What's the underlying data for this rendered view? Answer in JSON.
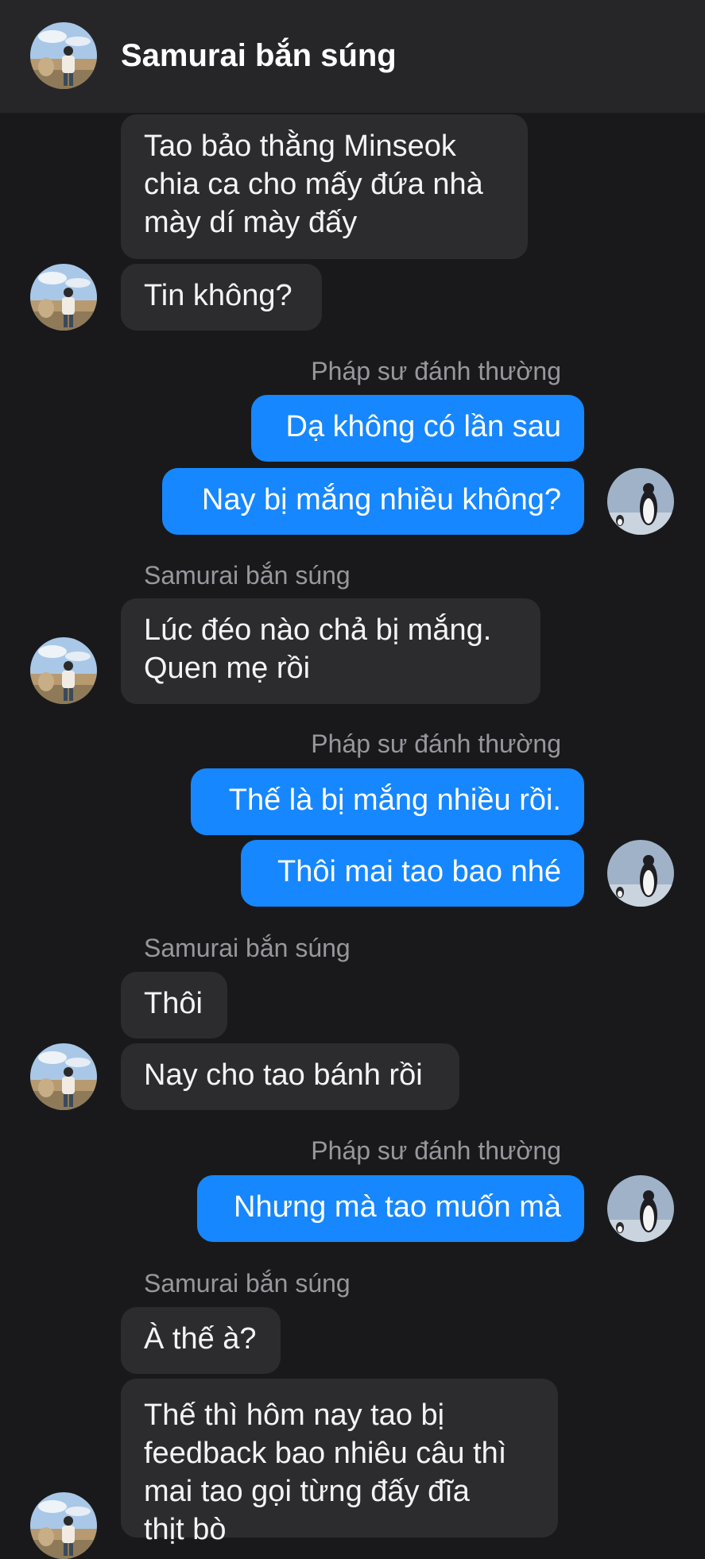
{
  "header": {
    "title": "Samurai bắn súng",
    "avatar_icon": "contact-avatar-photo-icon"
  },
  "colors": {
    "background": "#19191b",
    "header": "#262628",
    "incoming_bubble": "#2c2c2f",
    "outgoing_bubble": "#1687ff",
    "sender_label": "#97979d"
  },
  "messages": {
    "m1": {
      "direction": "incoming",
      "text": "Tao bảo thằng Minseok\nchia ca cho mấy đứa nhà\nmày dí mày đấy"
    },
    "m2": {
      "direction": "incoming",
      "text": "Tin không?"
    },
    "s1": {
      "sender": "Pháp sư đánh thường"
    },
    "m3": {
      "direction": "outgoing",
      "text": "Dạ không có lần sau"
    },
    "m4": {
      "direction": "outgoing",
      "text": "Nay bị mắng nhiều không?"
    },
    "s2": {
      "sender": "Samurai bắn súng"
    },
    "m5": {
      "direction": "incoming",
      "text": "Lúc đéo nào chả bị mắng.\nQuen mẹ rồi"
    },
    "s3": {
      "sender": "Pháp sư đánh thường"
    },
    "m6": {
      "direction": "outgoing",
      "text": "Thế là bị mắng nhiều rồi."
    },
    "m7": {
      "direction": "outgoing",
      "text": "Thôi mai tao bao nhé"
    },
    "s4": {
      "sender": "Samurai bắn súng"
    },
    "m8": {
      "direction": "incoming",
      "text": "Thôi"
    },
    "m9": {
      "direction": "incoming",
      "text": "Nay cho tao bánh rồi"
    },
    "s5": {
      "sender": "Pháp sư đánh thường"
    },
    "m10": {
      "direction": "outgoing",
      "text": "Nhưng mà tao muốn mà"
    },
    "s6": {
      "sender": "Samurai bắn súng"
    },
    "m11": {
      "direction": "incoming",
      "text": "À thế à?"
    },
    "m12": {
      "direction": "incoming",
      "text": "Thế thì hôm nay tao bị\nfeedback bao nhiêu câu thì\nmai tao gọi từng đấy đĩa\nthịt bò"
    }
  }
}
